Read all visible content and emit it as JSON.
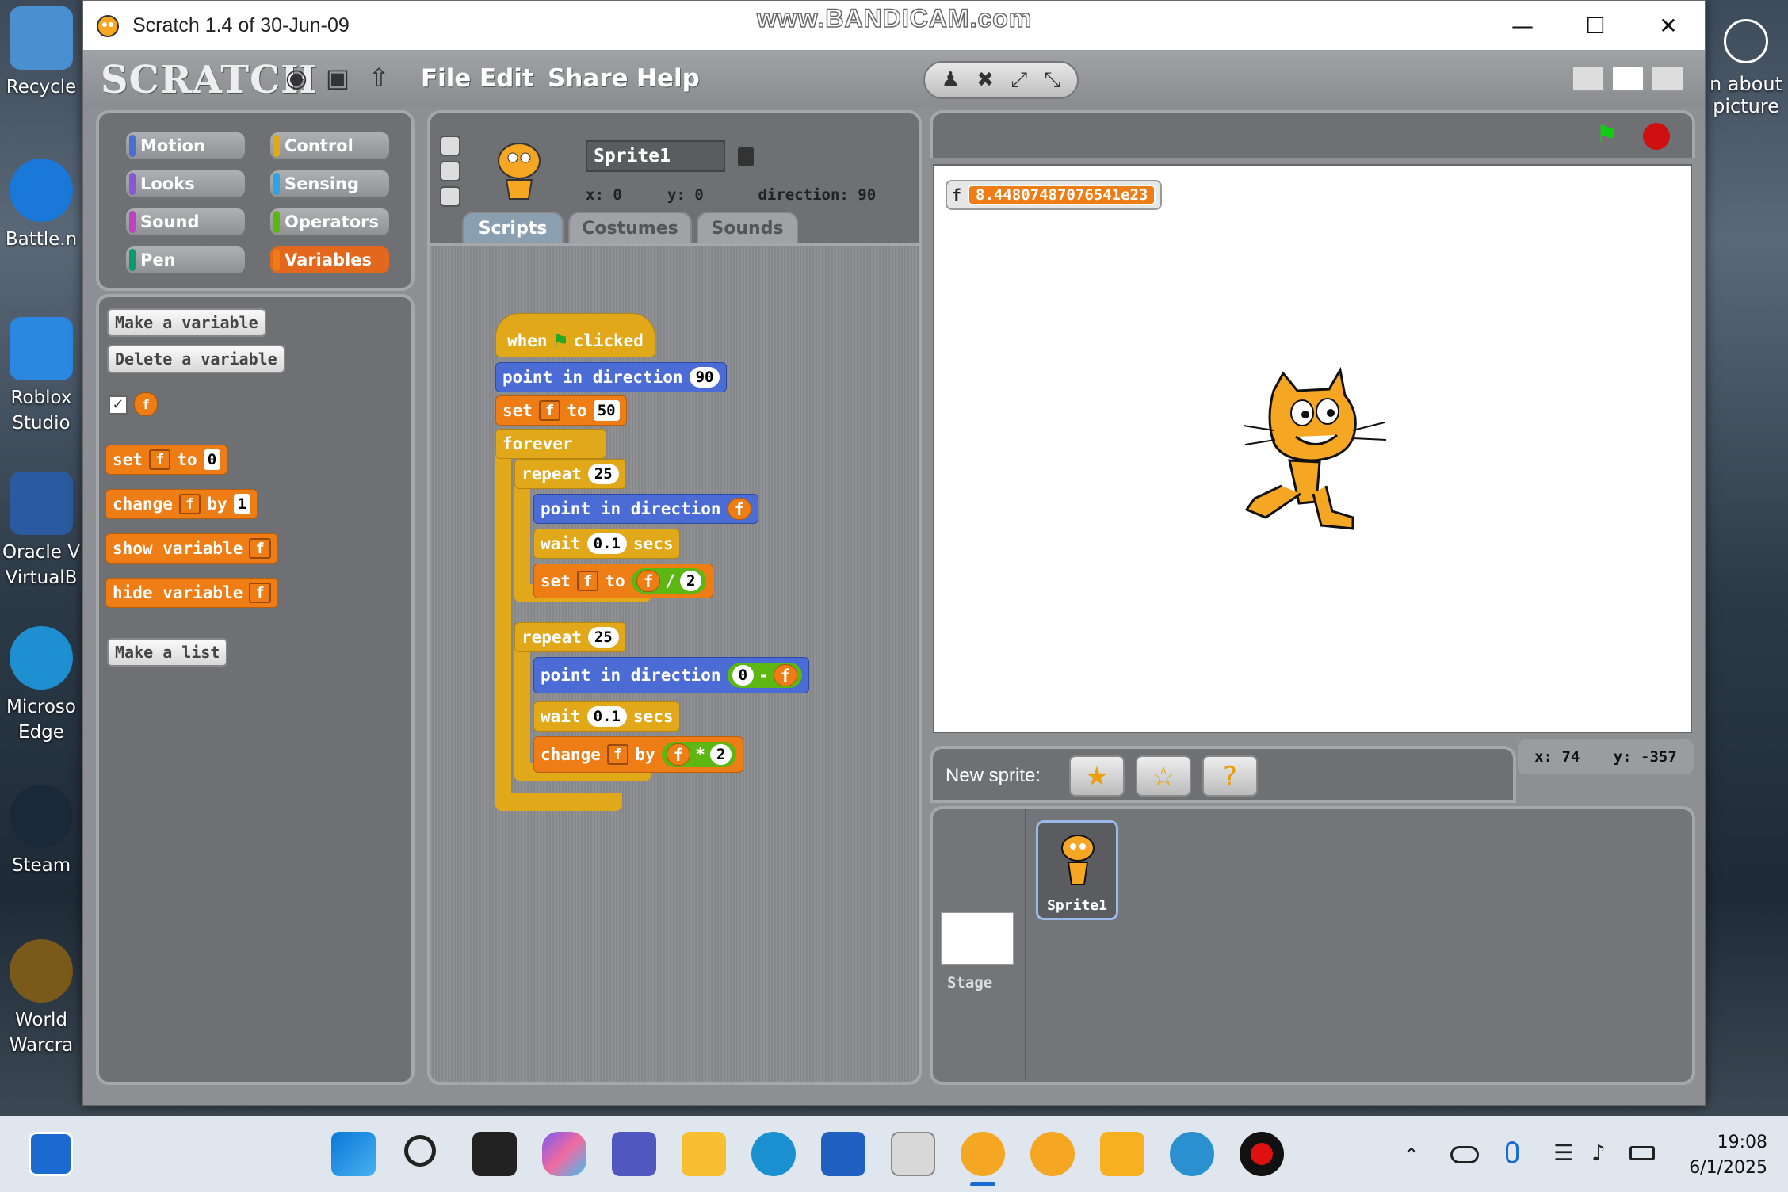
{
  "window": {
    "title": "Scratch 1.4 of 30-Jun-09",
    "watermark": "www.BANDICAM.com",
    "minimize": "—",
    "maximize": "☐",
    "close": "✕"
  },
  "desktop": {
    "icons": [
      {
        "label": "Recycle",
        "color": "#4a90d0"
      },
      {
        "label": "Battle.n",
        "color": "#1a78d8"
      },
      {
        "label": "Roblox Studio",
        "color": "#2a88e0"
      },
      {
        "label": "Oracle V VirtualB",
        "color": "#2c5aa0"
      },
      {
        "label": "Microso Edge",
        "color": "#1e8fd0"
      },
      {
        "label": "Steam",
        "color": "#1b2838"
      },
      {
        "label": "World Warcra",
        "color": "#7a5a1a"
      }
    ],
    "right_text": "n about picture"
  },
  "menubar": {
    "logo": "SCRATCH",
    "menus": [
      "File",
      "Edit",
      "Share",
      "Help"
    ]
  },
  "categories": {
    "motion": "Motion",
    "control": "Control",
    "looks": "Looks",
    "sensing": "Sensing",
    "sound": "Sound",
    "operators": "Operators",
    "pen": "Pen",
    "variables": "Variables"
  },
  "colors": {
    "motion": "#4a6cd4",
    "control": "#e1a91a",
    "looks": "#8a55d7",
    "sensing": "#2ca5e2",
    "sound": "#bb42c3",
    "operators": "#5cb712",
    "pen": "#0e9a6c",
    "variables": "#ee7d16"
  },
  "palette": {
    "make_variable": "Make a variable",
    "delete_variable": "Delete a variable",
    "var_name": "f",
    "set_block": {
      "label": "set",
      "var": "f",
      "to": "to",
      "value": "0"
    },
    "change_block": {
      "label": "change",
      "var": "f",
      "by": "by",
      "value": "1"
    },
    "show_variable": "show variable",
    "hide_variable": "hide variable",
    "make_list": "Make a list"
  },
  "sprite_info": {
    "name": "Sprite1",
    "x_label": "x:",
    "x": "0",
    "y_label": "y:",
    "y": "0",
    "direction_label": "direction:",
    "direction": "90"
  },
  "tabs": [
    "Scripts",
    "Costumes",
    "Sounds"
  ],
  "script": {
    "hat": {
      "when": "when",
      "clicked": "clicked"
    },
    "point1": {
      "label": "point in direction",
      "value": "90"
    },
    "set1": {
      "label": "set",
      "var": "f",
      "to": "to",
      "value": "50"
    },
    "forever": "forever",
    "repeat1": {
      "label": "repeat",
      "value": "25"
    },
    "point2": {
      "label": "point in direction",
      "var": "f"
    },
    "wait1": {
      "label": "wait",
      "value": "0.1",
      "secs": "secs"
    },
    "set2": {
      "label": "set",
      "var": "f",
      "to": "to",
      "a": "f",
      "op": "/",
      "b": "2"
    },
    "repeat2": {
      "label": "repeat",
      "value": "25"
    },
    "point3": {
      "label": "point in direction",
      "a": "0",
      "op": "-",
      "b": "f"
    },
    "wait2": {
      "label": "wait",
      "value": "0.1",
      "secs": "secs"
    },
    "change1": {
      "label": "change",
      "var": "f",
      "by": "by",
      "a": "f",
      "op": "*",
      "b": "2"
    }
  },
  "stage": {
    "monitor_name": "f",
    "monitor_value": "8.44807487076541e23",
    "mouse_x": "x: 74",
    "mouse_y": "y: -357"
  },
  "new_sprite": {
    "label": "New sprite:"
  },
  "sprites": {
    "stage_label": "Stage",
    "sprite1": "Sprite1"
  },
  "taskbar": {
    "time": "19:08",
    "date": "6/1/2025"
  }
}
